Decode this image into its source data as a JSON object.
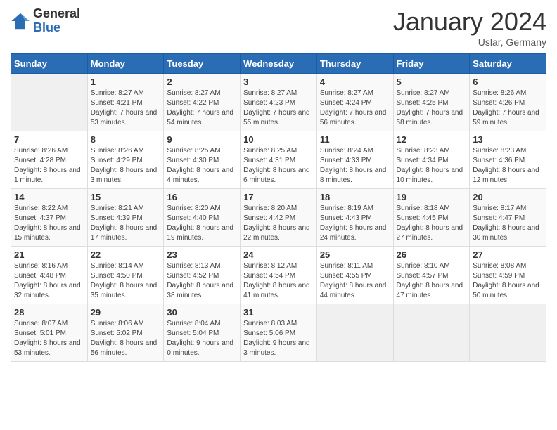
{
  "header": {
    "logo_general": "General",
    "logo_blue": "Blue",
    "title": "January 2024",
    "subtitle": "Uslar, Germany"
  },
  "weekdays": [
    "Sunday",
    "Monday",
    "Tuesday",
    "Wednesday",
    "Thursday",
    "Friday",
    "Saturday"
  ],
  "weeks": [
    [
      {
        "day": "",
        "sunrise": "",
        "sunset": "",
        "daylight": ""
      },
      {
        "day": "1",
        "sunrise": "Sunrise: 8:27 AM",
        "sunset": "Sunset: 4:21 PM",
        "daylight": "Daylight: 7 hours and 53 minutes."
      },
      {
        "day": "2",
        "sunrise": "Sunrise: 8:27 AM",
        "sunset": "Sunset: 4:22 PM",
        "daylight": "Daylight: 7 hours and 54 minutes."
      },
      {
        "day": "3",
        "sunrise": "Sunrise: 8:27 AM",
        "sunset": "Sunset: 4:23 PM",
        "daylight": "Daylight: 7 hours and 55 minutes."
      },
      {
        "day": "4",
        "sunrise": "Sunrise: 8:27 AM",
        "sunset": "Sunset: 4:24 PM",
        "daylight": "Daylight: 7 hours and 56 minutes."
      },
      {
        "day": "5",
        "sunrise": "Sunrise: 8:27 AM",
        "sunset": "Sunset: 4:25 PM",
        "daylight": "Daylight: 7 hours and 58 minutes."
      },
      {
        "day": "6",
        "sunrise": "Sunrise: 8:26 AM",
        "sunset": "Sunset: 4:26 PM",
        "daylight": "Daylight: 7 hours and 59 minutes."
      }
    ],
    [
      {
        "day": "7",
        "sunrise": "Sunrise: 8:26 AM",
        "sunset": "Sunset: 4:28 PM",
        "daylight": "Daylight: 8 hours and 1 minute."
      },
      {
        "day": "8",
        "sunrise": "Sunrise: 8:26 AM",
        "sunset": "Sunset: 4:29 PM",
        "daylight": "Daylight: 8 hours and 3 minutes."
      },
      {
        "day": "9",
        "sunrise": "Sunrise: 8:25 AM",
        "sunset": "Sunset: 4:30 PM",
        "daylight": "Daylight: 8 hours and 4 minutes."
      },
      {
        "day": "10",
        "sunrise": "Sunrise: 8:25 AM",
        "sunset": "Sunset: 4:31 PM",
        "daylight": "Daylight: 8 hours and 6 minutes."
      },
      {
        "day": "11",
        "sunrise": "Sunrise: 8:24 AM",
        "sunset": "Sunset: 4:33 PM",
        "daylight": "Daylight: 8 hours and 8 minutes."
      },
      {
        "day": "12",
        "sunrise": "Sunrise: 8:23 AM",
        "sunset": "Sunset: 4:34 PM",
        "daylight": "Daylight: 8 hours and 10 minutes."
      },
      {
        "day": "13",
        "sunrise": "Sunrise: 8:23 AM",
        "sunset": "Sunset: 4:36 PM",
        "daylight": "Daylight: 8 hours and 12 minutes."
      }
    ],
    [
      {
        "day": "14",
        "sunrise": "Sunrise: 8:22 AM",
        "sunset": "Sunset: 4:37 PM",
        "daylight": "Daylight: 8 hours and 15 minutes."
      },
      {
        "day": "15",
        "sunrise": "Sunrise: 8:21 AM",
        "sunset": "Sunset: 4:39 PM",
        "daylight": "Daylight: 8 hours and 17 minutes."
      },
      {
        "day": "16",
        "sunrise": "Sunrise: 8:20 AM",
        "sunset": "Sunset: 4:40 PM",
        "daylight": "Daylight: 8 hours and 19 minutes."
      },
      {
        "day": "17",
        "sunrise": "Sunrise: 8:20 AM",
        "sunset": "Sunset: 4:42 PM",
        "daylight": "Daylight: 8 hours and 22 minutes."
      },
      {
        "day": "18",
        "sunrise": "Sunrise: 8:19 AM",
        "sunset": "Sunset: 4:43 PM",
        "daylight": "Daylight: 8 hours and 24 minutes."
      },
      {
        "day": "19",
        "sunrise": "Sunrise: 8:18 AM",
        "sunset": "Sunset: 4:45 PM",
        "daylight": "Daylight: 8 hours and 27 minutes."
      },
      {
        "day": "20",
        "sunrise": "Sunrise: 8:17 AM",
        "sunset": "Sunset: 4:47 PM",
        "daylight": "Daylight: 8 hours and 30 minutes."
      }
    ],
    [
      {
        "day": "21",
        "sunrise": "Sunrise: 8:16 AM",
        "sunset": "Sunset: 4:48 PM",
        "daylight": "Daylight: 8 hours and 32 minutes."
      },
      {
        "day": "22",
        "sunrise": "Sunrise: 8:14 AM",
        "sunset": "Sunset: 4:50 PM",
        "daylight": "Daylight: 8 hours and 35 minutes."
      },
      {
        "day": "23",
        "sunrise": "Sunrise: 8:13 AM",
        "sunset": "Sunset: 4:52 PM",
        "daylight": "Daylight: 8 hours and 38 minutes."
      },
      {
        "day": "24",
        "sunrise": "Sunrise: 8:12 AM",
        "sunset": "Sunset: 4:54 PM",
        "daylight": "Daylight: 8 hours and 41 minutes."
      },
      {
        "day": "25",
        "sunrise": "Sunrise: 8:11 AM",
        "sunset": "Sunset: 4:55 PM",
        "daylight": "Daylight: 8 hours and 44 minutes."
      },
      {
        "day": "26",
        "sunrise": "Sunrise: 8:10 AM",
        "sunset": "Sunset: 4:57 PM",
        "daylight": "Daylight: 8 hours and 47 minutes."
      },
      {
        "day": "27",
        "sunrise": "Sunrise: 8:08 AM",
        "sunset": "Sunset: 4:59 PM",
        "daylight": "Daylight: 8 hours and 50 minutes."
      }
    ],
    [
      {
        "day": "28",
        "sunrise": "Sunrise: 8:07 AM",
        "sunset": "Sunset: 5:01 PM",
        "daylight": "Daylight: 8 hours and 53 minutes."
      },
      {
        "day": "29",
        "sunrise": "Sunrise: 8:06 AM",
        "sunset": "Sunset: 5:02 PM",
        "daylight": "Daylight: 8 hours and 56 minutes."
      },
      {
        "day": "30",
        "sunrise": "Sunrise: 8:04 AM",
        "sunset": "Sunset: 5:04 PM",
        "daylight": "Daylight: 9 hours and 0 minutes."
      },
      {
        "day": "31",
        "sunrise": "Sunrise: 8:03 AM",
        "sunset": "Sunset: 5:06 PM",
        "daylight": "Daylight: 9 hours and 3 minutes."
      },
      {
        "day": "",
        "sunrise": "",
        "sunset": "",
        "daylight": ""
      },
      {
        "day": "",
        "sunrise": "",
        "sunset": "",
        "daylight": ""
      },
      {
        "day": "",
        "sunrise": "",
        "sunset": "",
        "daylight": ""
      }
    ]
  ]
}
